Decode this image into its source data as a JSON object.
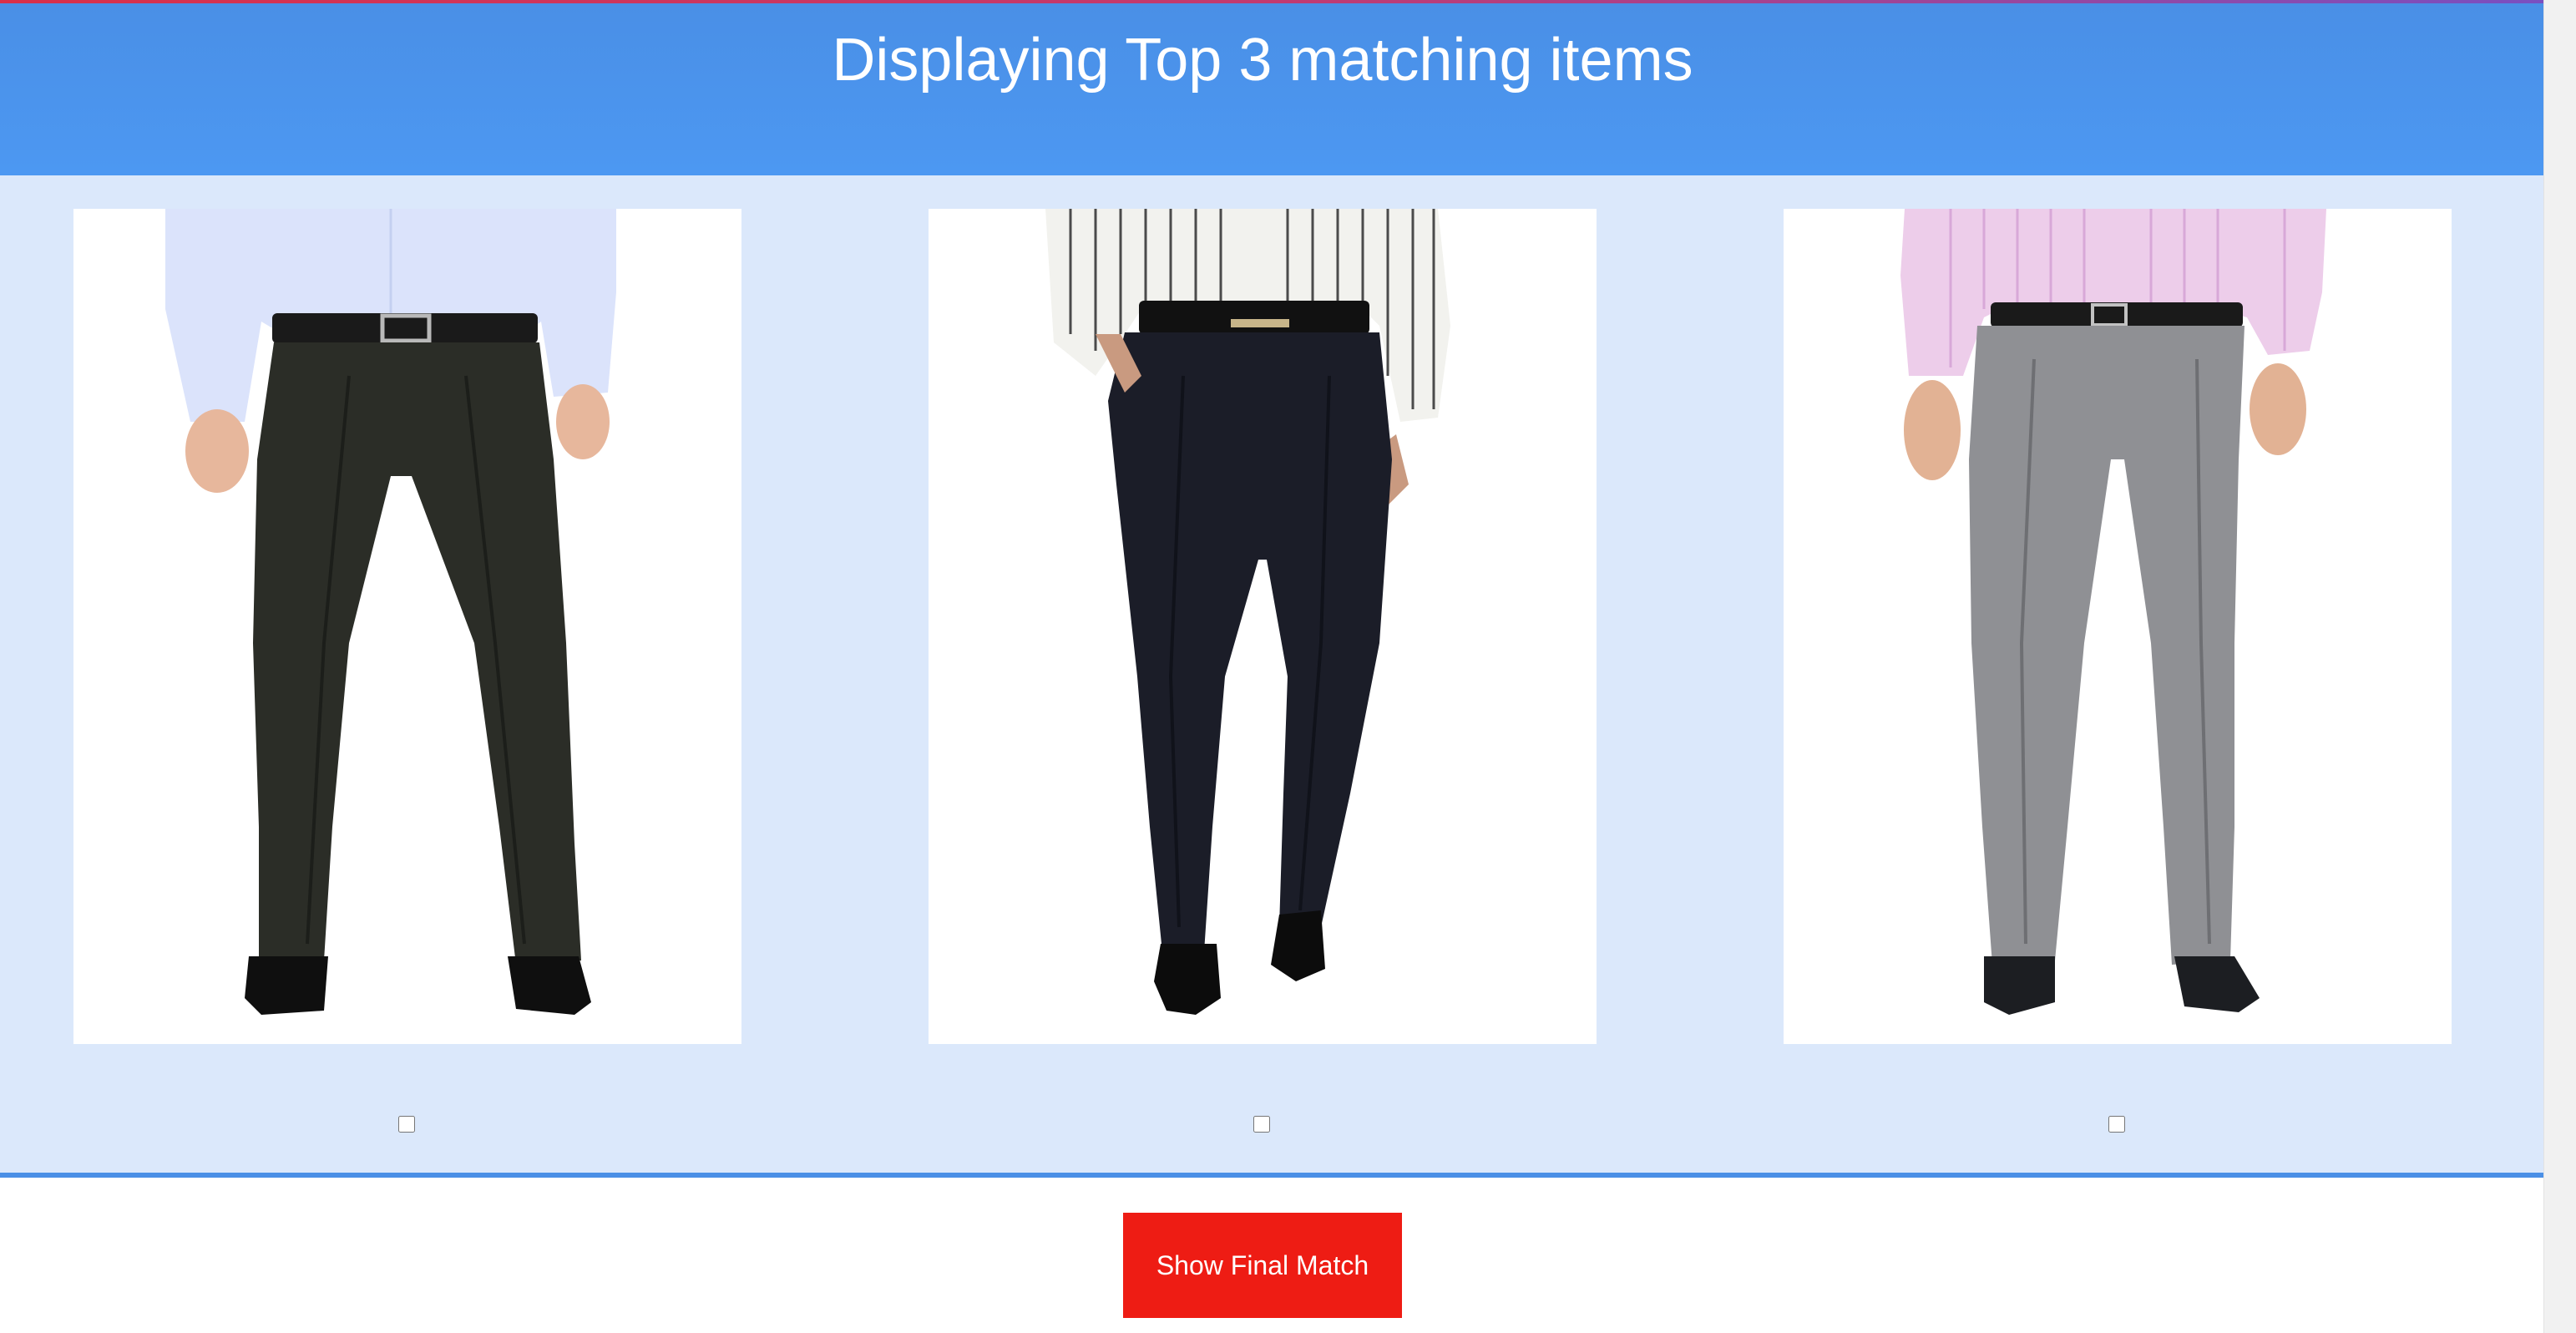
{
  "header": {
    "title": "Displaying Top 3 matching items"
  },
  "items": [
    {
      "image_alt": "Man wearing dark charcoal formal trousers with light blue shirt",
      "shirt_color": "#dbe3fb",
      "shirt_stripe": "#c4d0f0",
      "pants_color": "#2b2d27",
      "pants_shade": "#1c1e1a",
      "selected": false
    },
    {
      "image_alt": "Man wearing black formal trousers with white striped shirt",
      "shirt_color": "#f2f2ee",
      "shirt_stripe": "#4b4b4b",
      "pants_color": "#1b1d28",
      "pants_shade": "#10121a",
      "selected": false
    },
    {
      "image_alt": "Man wearing grey formal trousers with pink shirt",
      "shirt_color": "#edcdea",
      "shirt_stripe": "#d8a8d8",
      "pants_color": "#8f9094",
      "pants_shade": "#6e6f73",
      "selected": false
    }
  ],
  "actions": {
    "final_match_label": "Show Final Match"
  },
  "colors": {
    "header_bg": "#4a8fe6",
    "gallery_bg": "#dbe8fb",
    "button_bg": "#ee1c14"
  }
}
